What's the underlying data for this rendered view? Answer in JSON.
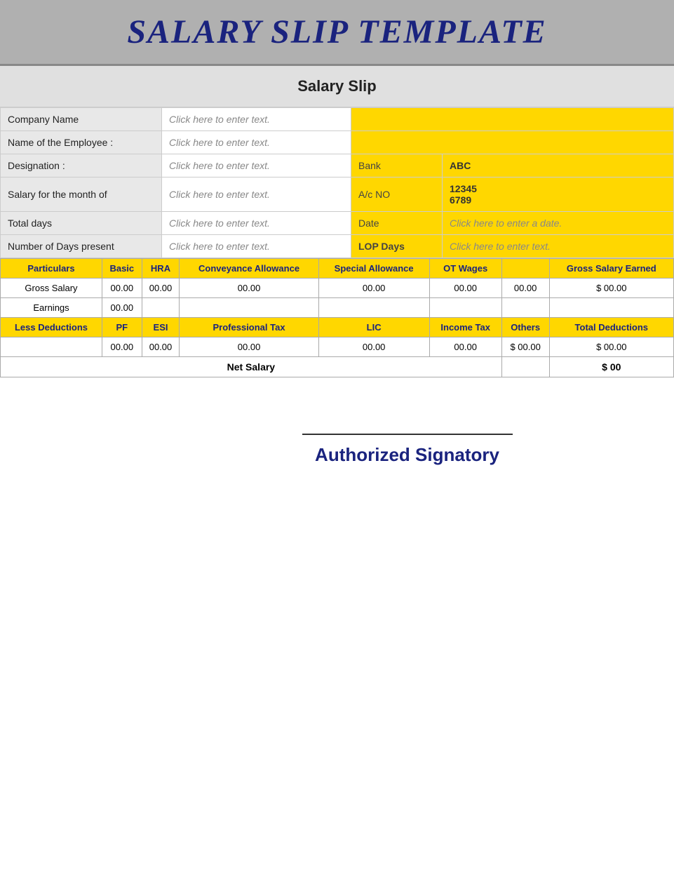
{
  "header": {
    "title": "Salary Slip Template",
    "subtitle": "Salary Slip"
  },
  "info": {
    "company_name_label": "Company Name",
    "company_name_placeholder": "Click here to enter text.",
    "employee_name_label": "Name of the Employee :",
    "employee_name_placeholder": "Click here to enter text.",
    "designation_label": "Designation :",
    "designation_placeholder": "Click here to enter text.",
    "bank_label": "Bank",
    "bank_value": "ABC",
    "salary_month_label": "Salary for the month of",
    "salary_month_placeholder": "Click here to enter text.",
    "account_no_label": "A/c NO",
    "account_no_value": "12345 6789",
    "total_days_label": "Total days",
    "total_days_placeholder": "Click here to enter text.",
    "date_label": "Date",
    "date_placeholder": "Click here to enter a date.",
    "days_present_label": "Number of Days present",
    "days_present_placeholder": "Click here to enter text.",
    "lop_label": "LOP Days",
    "lop_placeholder": "Click here to enter text."
  },
  "salary_table": {
    "headers": {
      "particulars": "Particulars",
      "basic": "Basic",
      "hra": "HRA",
      "conveyance": "Conveyance Allowance",
      "special": "Special Allowance",
      "ot_wages": "OT Wages",
      "col7": "",
      "gross_salary_earned": "Gross Salary Earned"
    },
    "gross_salary_label": "Gross Salary",
    "earnings_label": "Earnings",
    "values": {
      "basic": "00.00",
      "hra": "00.00",
      "conveyance": "00.00",
      "special": "00.00",
      "ot_wages": "00.00",
      "col7": "00.00",
      "gross_earned": "$ 00.00",
      "earnings_basic": "00.00"
    },
    "deduction_headers": {
      "less_deductions": "Less Deductions",
      "pf": "PF",
      "esi": "ESI",
      "professional_tax": "Professional Tax",
      "lic": "LIC",
      "income_tax": "Income Tax",
      "others": "Others",
      "total_deductions": "Total Deductions"
    },
    "deduction_values": {
      "pf": "00.00",
      "esi": "00.00",
      "professional_tax": "00.00",
      "lic": "00.00",
      "income_tax": "00.00",
      "others": "$ 00.00",
      "total": "$ 00.00"
    },
    "net_salary_label": "Net Salary",
    "net_salary_value": "$ 00"
  },
  "signature": {
    "line_text": "",
    "authorized_text": "Authorized Signatory"
  }
}
